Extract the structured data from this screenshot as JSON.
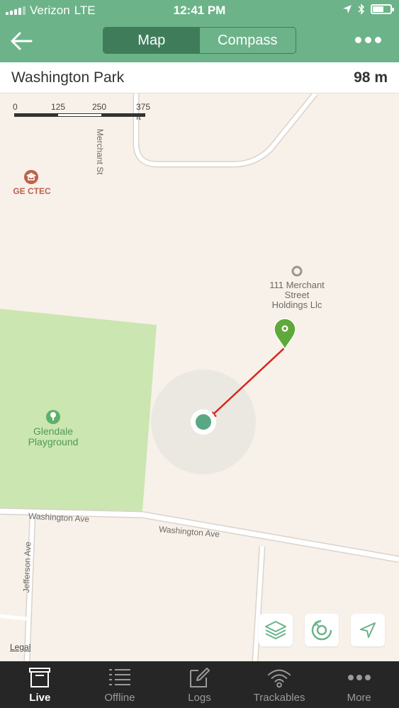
{
  "status_bar": {
    "carrier": "Verizon",
    "network": "LTE",
    "time": "12:41 PM",
    "battery_level": 0.65
  },
  "nav": {
    "segments": [
      {
        "label": "Map",
        "active": true
      },
      {
        "label": "Compass",
        "active": false
      }
    ]
  },
  "info": {
    "title": "Washington Park",
    "distance": "98 m"
  },
  "map": {
    "scale_labels": [
      "0",
      "125",
      "250",
      "375 ft"
    ],
    "streets": {
      "merchant": "Merchant St",
      "washington_1": "Washington Ave",
      "washington_2": "Washington Ave",
      "jefferson": "Jefferson Ave"
    },
    "pois": {
      "school": "GE CTEC",
      "business": "111 Merchant\nStreet\nHoldings Llc",
      "park": "Glendale\nPlayground"
    },
    "legal": "Legal",
    "colors": {
      "park": "#cbe6b1",
      "accent": "#6db389",
      "pin": "#5fa83a",
      "arrow": "#d8241c",
      "user_dot": "#5aa883",
      "school": "#c0614a"
    }
  },
  "map_controls": [
    {
      "name": "layers-button",
      "icon": "layers-icon"
    },
    {
      "name": "radar-button",
      "icon": "radar-icon"
    },
    {
      "name": "locate-button",
      "icon": "location-arrow-icon"
    }
  ],
  "tabs": [
    {
      "label": "Live",
      "icon": "live-icon",
      "active": true
    },
    {
      "label": "Offline",
      "icon": "list-icon",
      "active": false
    },
    {
      "label": "Logs",
      "icon": "edit-icon",
      "active": false
    },
    {
      "label": "Trackables",
      "icon": "wifi-icon",
      "active": false
    },
    {
      "label": "More",
      "icon": "more-icon",
      "active": false
    }
  ]
}
